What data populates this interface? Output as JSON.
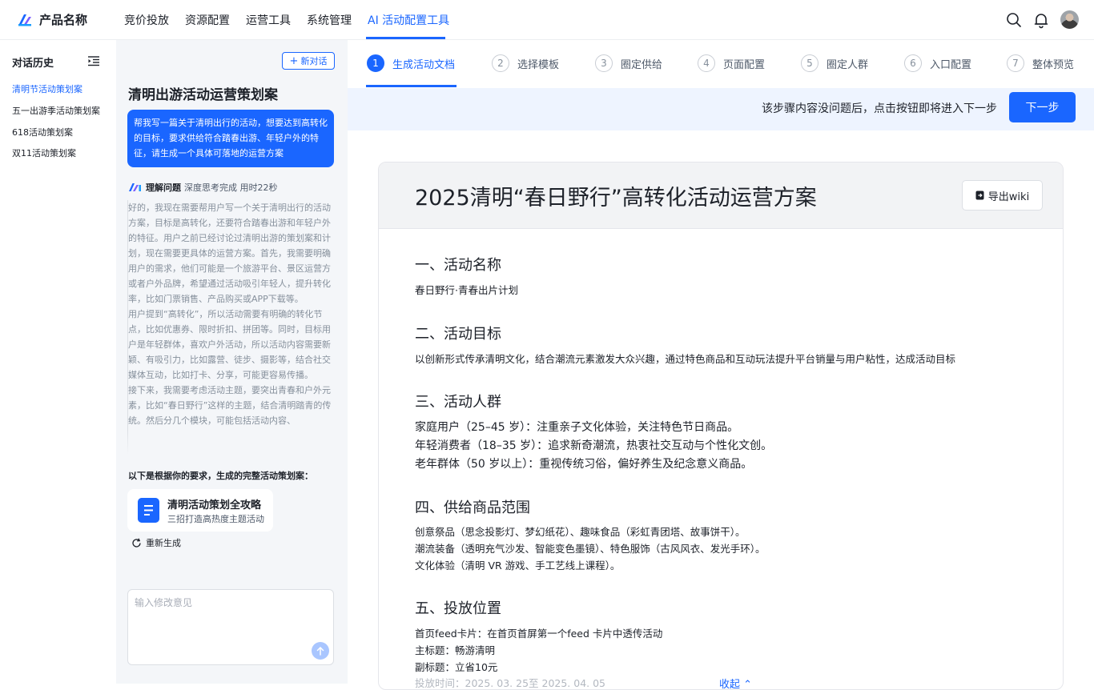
{
  "app": {
    "product_name": "产品名称",
    "nav": [
      "竞价投放",
      "资源配置",
      "运营工具",
      "系统管理",
      "AI 活动配置工具"
    ],
    "accent": "#1a66ff"
  },
  "history": {
    "title": "对话历史",
    "items": [
      "清明节活动策划案",
      "五一出游季活动策划案",
      "618活动策划案",
      "双11活动策划案"
    ]
  },
  "chat": {
    "new_chat": "新对话",
    "title": "清明出游活动运营策划案",
    "user_message": "帮我写一篇关于清明出行的活动，想要达到高转化的目标，要求供给符合踏春出游、年轻户外的特征，请生成一个具体可落地的运营方案",
    "thinking_label": "理解问题",
    "thinking_meta": "深度思考完成 用时22秒",
    "thinking_text": [
      "好的，我现在需要帮用户写一个关于清明出行的活动方案，目标是高转化，还要符合踏春出游和年轻户外的特征。用户之前已经讨论过清明出游的策划案和计划，现在需要更具体的运营方案。首先，我需要明确用户的需求，他们可能是一个旅游平台、景区运营方或者户外品牌，希望通过活动吸引年轻人，提升转化率，比如门票销售、产品购买或APP下载等。",
      "用户提到“高转化”，所以活动需要有明确的转化节点，比如优惠券、限时折扣、拼团等。同时，目标用户是年轻群体，喜欢户外活动，所以活动内容需要新颖、有吸引力，比如露营、徒步、摄影等，结合社交媒体互动，比如打卡、分享，可能更容易传播。",
      "接下来，我需要考虑活动主题，要突出青春和户外元素，比如“春日野行”这样的主题，结合清明踏青的传统。然后分几个模块，可能包括活动内容、"
    ],
    "result_intro": "以下是根据你的要求，生成的完整活动策划案：",
    "doc_card_title": "清明活动策划全攻略",
    "doc_card_sub": "三招打造高热度主题活动",
    "regenerate": "重新生成",
    "input_placeholder": "输入修改意见"
  },
  "steps": [
    {
      "num": "1",
      "label": "生成活动文档",
      "active": true
    },
    {
      "num": "2",
      "label": "选择模板",
      "active": false
    },
    {
      "num": "3",
      "label": "圈定供给",
      "active": false
    },
    {
      "num": "4",
      "label": "页面配置",
      "active": false
    },
    {
      "num": "5",
      "label": "圈定人群",
      "active": false
    },
    {
      "num": "6",
      "label": "入口配置",
      "active": false
    },
    {
      "num": "7",
      "label": "整体预览",
      "active": false
    }
  ],
  "banner": {
    "text": "该步骤内容没问题后，点击按钮即将进入下一步",
    "next_label": "下一步"
  },
  "doc": {
    "title": "2025清明“春日野行”高转化活动运营方案",
    "export_label": "导出wiki",
    "s1_h": "一、活动名称",
    "s1_p": "春日野行·青春出片计划",
    "s2_h": "二、活动目标",
    "s2_p": "以创新形式传承清明文化，结合潮流元素激发大众兴趣，通过特色商品和互动玩法提升平台销量与用户粘性，达成活动目标",
    "s3_h": "三、活动人群",
    "s3_lines": [
      "家庭用户（25–45 岁）：注重亲子文化体验，关注特色节日商品。",
      "年轻消费者（18–35 岁）：追求新奇潮流，热衷社交互动与个性化文创。",
      "老年群体（50 岁以上）：重视传统习俗，偏好养生及纪念意义商品。"
    ],
    "s4_h": "四、供给商品范围",
    "s4_lines": [
      "创意祭品（思念投影灯、梦幻纸花）、趣味食品（彩虹青团塔、故事饼干）。",
      "潮流装备（透明充气沙发、智能变色墨镜）、特色服饰（古风风衣、发光手环）。",
      "文化体验（清明 VR 游戏、手工艺线上课程）。"
    ],
    "s5_h": "五、投放位置",
    "s5_lines": [
      "首页feed卡片：在首页首屏第一个feed 卡片中透传活动",
      "主标题：畅游清明",
      "副标题：立省10元"
    ],
    "s5_faded": "投放时间：2025. 03. 25至 2025. 04. 05",
    "collapse": "收起 ⌃"
  }
}
